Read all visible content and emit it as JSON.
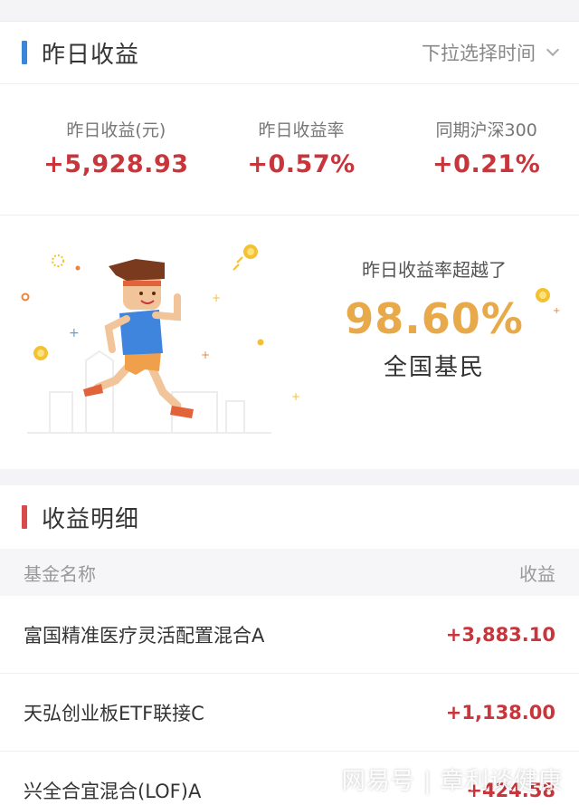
{
  "summary": {
    "title": "昨日收益",
    "time_select": "下拉选择时间",
    "accent": "#3a86d8",
    "stats": [
      {
        "label": "昨日收益(元)",
        "value": "+5,928.93"
      },
      {
        "label": "昨日收益率",
        "value": "+0.57%"
      },
      {
        "label": "同期沪深300",
        "value": "+0.21%"
      }
    ]
  },
  "ranking": {
    "caption": "昨日收益率超越了",
    "percent": "98.60%",
    "who": "全国基民"
  },
  "detail": {
    "title": "收益明细",
    "accent": "#d94a4a",
    "col_name": "基金名称",
    "col_amount": "收益",
    "rows": [
      {
        "name": "富国精准医疗灵活配置混合A",
        "amount": "+3,883.10"
      },
      {
        "name": "天弘创业板ETF联接C",
        "amount": "+1,138.00"
      },
      {
        "name": "兴全合宜混合(LOF)A",
        "amount": "+424.58"
      }
    ]
  },
  "watermark": "网易号 | 章利谈健康",
  "colors": {
    "gain": "#c8353b",
    "rank_percent": "#e8a94a"
  }
}
